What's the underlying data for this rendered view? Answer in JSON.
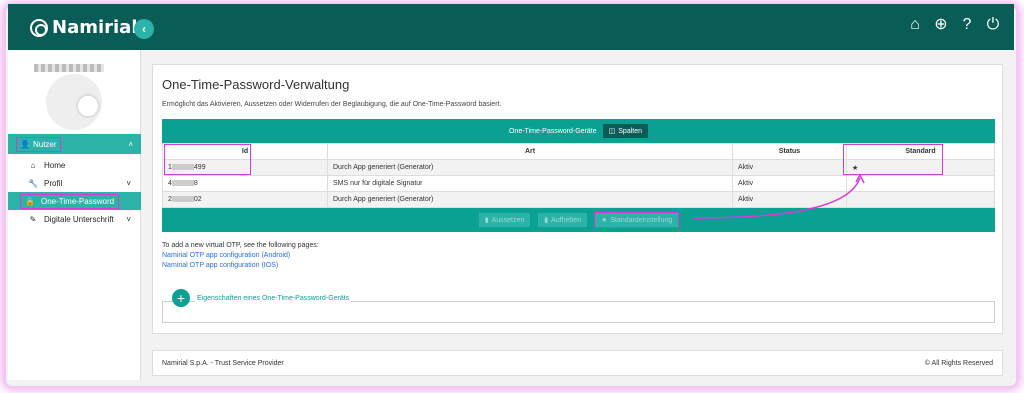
{
  "app": {
    "logo_text": "Namirial"
  },
  "topbar": {
    "icons": [
      "home-icon",
      "globe-icon",
      "help-icon",
      "power-icon"
    ]
  },
  "sidebar": {
    "user_section": "Nutzer",
    "items": [
      {
        "label": "Home",
        "icon": "home-icon"
      },
      {
        "label": "Profil",
        "icon": "wrench-icon"
      },
      {
        "label": "One-Time-Password",
        "icon": "lock-icon",
        "active": true
      },
      {
        "label": "Digitale Unterschrift",
        "icon": "edit-icon"
      }
    ]
  },
  "main": {
    "title": "One-Time-Password-Verwaltung",
    "description": "Ermöglicht das Aktivieren, Aussetzen oder Widerrufen der Beglaubigung, die auf One-Time-Password basiert.",
    "table": {
      "title": "One-Time-Password-Geräte",
      "columns_button": "Spalten",
      "headers": [
        "Id",
        "Art",
        "Status",
        "Standard"
      ],
      "rows": [
        {
          "id_start": "1",
          "id_end": "499",
          "art": "Durch App generiert (Generator)",
          "status": "Aktiv",
          "standard": "★"
        },
        {
          "id_start": "4",
          "id_end": "8",
          "art": "SMS nur für digitale Signatur",
          "status": "Aktiv",
          "standard": ""
        },
        {
          "id_start": "2",
          "id_end": "02",
          "art": "Durch App generiert (Generator)",
          "status": "Aktiv",
          "standard": ""
        }
      ],
      "actions": [
        "Aussetzen",
        "Aufheben",
        "Standardeinstellung"
      ]
    },
    "info_text": "To add a new virtual OTP, see the following pages:",
    "links": [
      "Namirial OTP app configuration (Android)",
      "Namirial OTP app configuration (IOS)"
    ],
    "properties_label": "Eigenschaften eines One-Time-Password-Geräts"
  },
  "footer": {
    "left": "Namirial S.p.A. - Trust Service Provider",
    "right": "All Rights Reserved"
  },
  "colors": {
    "topbar": "#0a5c57",
    "accent": "#0aa192",
    "highlight": "#d43cd4"
  }
}
